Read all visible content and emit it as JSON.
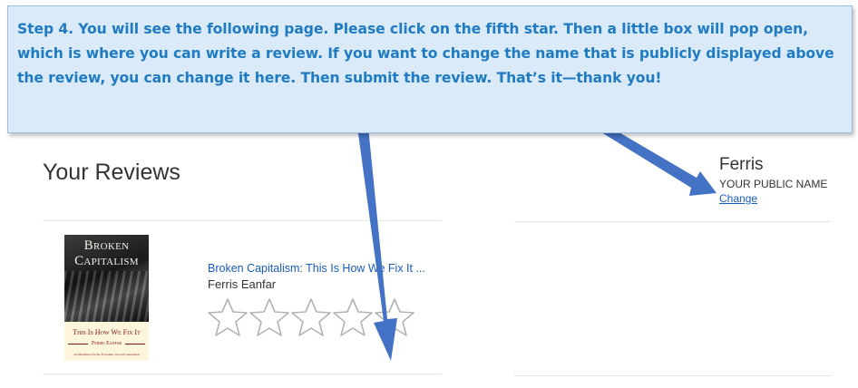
{
  "instruction": {
    "text": "Step 4. You will see the following page. Please click on the fifth star. Then a little box will pop open, which is where you can write a review. If you want to change the name that is publicly displayed above the review, you can change it here. Then submit the review. That’s it—thank you!"
  },
  "reviews": {
    "title": "Your Reviews"
  },
  "profile": {
    "name": "Ferris",
    "label": "YOUR PUBLIC NAME",
    "change_link": "Change"
  },
  "book": {
    "cover_title_1": "Broken",
    "cover_title_2": "Capitalism",
    "cover_subtitle": "This Is How We Fix It",
    "cover_author": "Ferris Eanfar",
    "cover_small": "An Manifesto for the Economic Growth Generation",
    "title": "Broken Capitalism: This Is How We Fix It ...",
    "author": "Ferris Eanfar",
    "rating": {
      "filled": 0,
      "max": 5
    }
  },
  "colors": {
    "callout_text": "#1f7cc2",
    "callout_bg": "#dbeaf9",
    "arrow": "#4472c4",
    "link": "#1a5bbf"
  },
  "icons": {
    "star": "star-outline-icon",
    "arrow": "pointer-arrow-icon"
  }
}
